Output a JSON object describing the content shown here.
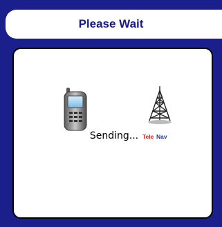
{
  "dialog": {
    "title": "Please Wait",
    "status": "Sending...",
    "brand": "TeleNav"
  },
  "icons": {
    "device": "mobile-phone-icon",
    "network": "telenav-tower-icon"
  },
  "colors": {
    "frame": "#1a1f8c",
    "title_text": "#1a1a8c",
    "panel": "#ffffff",
    "brand_red": "#d2231b",
    "brand_blue": "#1e3a9a"
  }
}
